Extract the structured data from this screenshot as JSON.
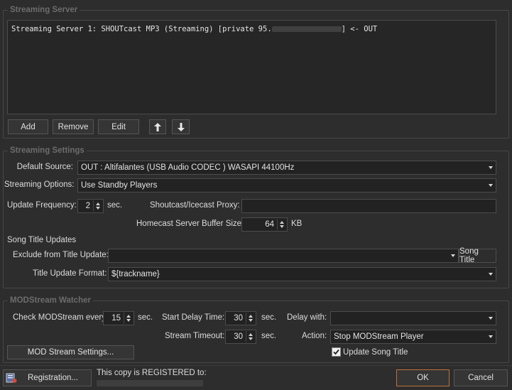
{
  "streaming_server": {
    "title": "Streaming Server",
    "server_line_prefix": "Streaming Server 1: SHOUTcast MP3 (Streaming) [private 95.",
    "server_line_suffix": "] <- OUT",
    "add_label": "Add",
    "remove_label": "Remove",
    "edit_label": "Edit"
  },
  "streaming_settings": {
    "title": "Streaming Settings",
    "default_source_label": "Default Source:",
    "default_source_value": "OUT  : Altifalantes (USB Audio CODEC ) WASAPI 44100Hz",
    "streaming_options_label": "Streaming Options:",
    "streaming_options_value": "Use Standby Players",
    "update_frequency_label": "Update Frequency:",
    "update_frequency_value": "2",
    "update_frequency_unit": "sec.",
    "proxy_label": "Shoutcast/Icecast Proxy:",
    "proxy_value": "",
    "buffer_label": "Homecast Server Buffer Size:",
    "buffer_value": "64",
    "buffer_unit": "KB",
    "song_title_updates_label": "Song Title Updates",
    "exclude_label": "Exclude from Title Update:",
    "exclude_value": "",
    "song_title_option": "Song Title",
    "format_label": "Title Update Format:",
    "format_value": "${trackname}"
  },
  "modstream": {
    "title": "MODStream Watcher",
    "check_label": "Check MODStream every:",
    "check_value": "15",
    "check_unit": "sec.",
    "start_delay_label": "Start Delay Time:",
    "start_delay_value": "30",
    "start_delay_unit": "sec.",
    "delay_with_label": "Delay with:",
    "delay_with_value": "",
    "timeout_label": "Stream Timeout:",
    "timeout_value": "30",
    "timeout_unit": "sec.",
    "action_label": "Action:",
    "action_value": "Stop MODStream Player",
    "settings_button": "MOD Stream Settings...",
    "update_song_title_label": "Update Song Title",
    "update_song_title_checked": true
  },
  "footer": {
    "registration_label": "Registration...",
    "registered_text": "This copy is REGISTERED to:",
    "ok_label": "OK",
    "cancel_label": "Cancel"
  },
  "colors": {
    "background": "#2d2d2d",
    "ok_border": "#c0703a"
  }
}
